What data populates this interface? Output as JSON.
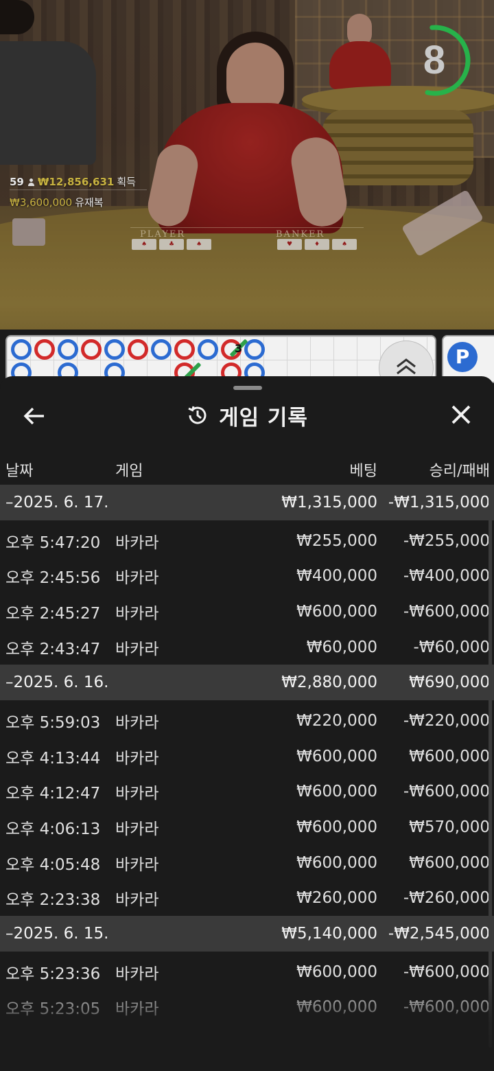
{
  "video": {
    "player_count": "59",
    "winnings_amount": "₩12,856,631",
    "winnings_label": "획득",
    "top_bet_amount": "₩3,600,000",
    "top_bet_user": "유재복",
    "player_felt_label": "PLAYER",
    "banker_felt_label": "BANKER",
    "countdown": "8",
    "countdown_progress": 0.55
  },
  "road": {
    "row1": [
      "p",
      "b",
      "p",
      "b",
      "p",
      "b",
      "p",
      "b",
      "p",
      "b",
      "p"
    ],
    "row2": [
      "p",
      "",
      "p",
      "",
      "p",
      "",
      "",
      "b",
      "",
      "b",
      "p"
    ],
    "marker_number": "3",
    "badge_letter": "P"
  },
  "sheet": {
    "title": "게임 기록",
    "columns": {
      "date": "날짜",
      "game": "게임",
      "bet": "베팅",
      "result": "승리/패배"
    },
    "groups": [
      {
        "date": "–2025. 6. 17.",
        "bet_total": "₩1,315,000",
        "result_total": "-₩1,315,000",
        "items": [
          {
            "time": "오후 5:47:20",
            "game": "바카라",
            "bet": "₩255,000",
            "result": "-₩255,000"
          },
          {
            "time": "오후 2:45:56",
            "game": "바카라",
            "bet": "₩400,000",
            "result": "-₩400,000"
          },
          {
            "time": "오후 2:45:27",
            "game": "바카라",
            "bet": "₩600,000",
            "result": "-₩600,000"
          },
          {
            "time": "오후 2:43:47",
            "game": "바카라",
            "bet": "₩60,000",
            "result": "-₩60,000"
          }
        ]
      },
      {
        "date": "–2025. 6. 16.",
        "bet_total": "₩2,880,000",
        "result_total": "₩690,000",
        "items": [
          {
            "time": "오후 5:59:03",
            "game": "바카라",
            "bet": "₩220,000",
            "result": "-₩220,000"
          },
          {
            "time": "오후 4:13:44",
            "game": "바카라",
            "bet": "₩600,000",
            "result": "₩600,000"
          },
          {
            "time": "오후 4:12:47",
            "game": "바카라",
            "bet": "₩600,000",
            "result": "-₩600,000"
          },
          {
            "time": "오후 4:06:13",
            "game": "바카라",
            "bet": "₩600,000",
            "result": "₩570,000"
          },
          {
            "time": "오후 4:05:48",
            "game": "바카라",
            "bet": "₩600,000",
            "result": "₩600,000"
          },
          {
            "time": "오후 2:23:38",
            "game": "바카라",
            "bet": "₩260,000",
            "result": "-₩260,000"
          }
        ]
      },
      {
        "date": "–2025. 6. 15.",
        "bet_total": "₩5,140,000",
        "result_total": "-₩2,545,000",
        "items": [
          {
            "time": "오후 5:23:36",
            "game": "바카라",
            "bet": "₩600,000",
            "result": "-₩600,000"
          },
          {
            "time": "오후 5:23:05",
            "game": "바카라",
            "bet": "₩600,000",
            "result": "-₩600,000"
          }
        ]
      }
    ]
  },
  "colors": {
    "sheet_bg": "#1b1b1b",
    "date_row_bg": "#3a3a3a",
    "player_blue": "#2c6bd1",
    "banker_red": "#d22a2a",
    "timer_green": "#27b24a",
    "gold_text": "#c8b340"
  },
  "icons": {
    "back": "arrow-left-icon",
    "history": "history-clock-icon",
    "close": "close-x-icon",
    "scroll_up": "double-chevron-up-icon",
    "person": "person-icon"
  }
}
